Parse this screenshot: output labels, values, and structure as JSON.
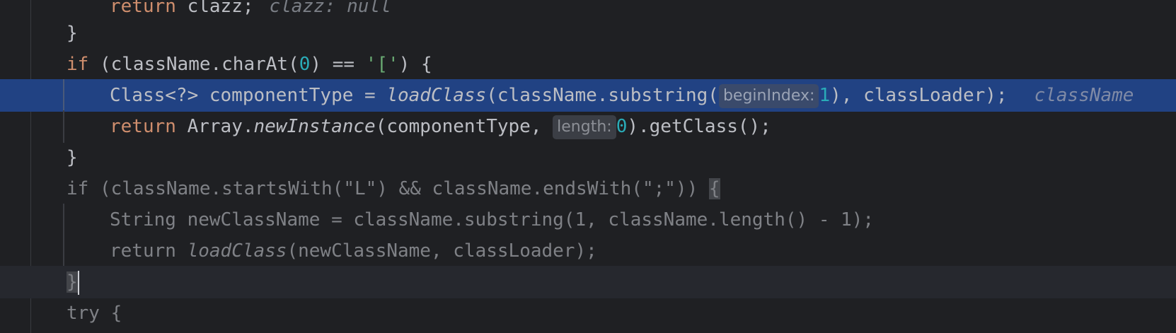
{
  "lines": {
    "l0": {
      "kw": "return",
      "text": " clazz;",
      "comment": "clazz: null"
    },
    "l1": {
      "text": "}"
    },
    "l2": {
      "kw": "if",
      "a": " (className.charAt(",
      "num": "0",
      "b": ") == ",
      "str": "'['",
      "c": ") {"
    },
    "l3": {
      "a": "Class<?> componentType = ",
      "fn": "loadClass",
      "b": "(className.substring(",
      "hint": "beginIndex:",
      "num": "1",
      "c": "), classLoader);",
      "trail": "className"
    },
    "l4": {
      "kw": "return",
      "a": " Array.",
      "fn": "newInstance",
      "b": "(componentType, ",
      "hint": "length:",
      "num": "0",
      "c": ").getClass();"
    },
    "l5": {
      "text": "}"
    },
    "l6": {
      "a": "if (className.startsWith(\"L\") && className.endsWith(\";\")) ",
      "brace": "{"
    },
    "l7": {
      "text": "String newClassName = className.substring(1, className.length() - 1);"
    },
    "l8": {
      "a": "return ",
      "fn": "loadClass",
      "b": "(newClassName, classLoader);"
    },
    "l9": {
      "text": "}"
    },
    "l10": {
      "text": "try {"
    }
  }
}
